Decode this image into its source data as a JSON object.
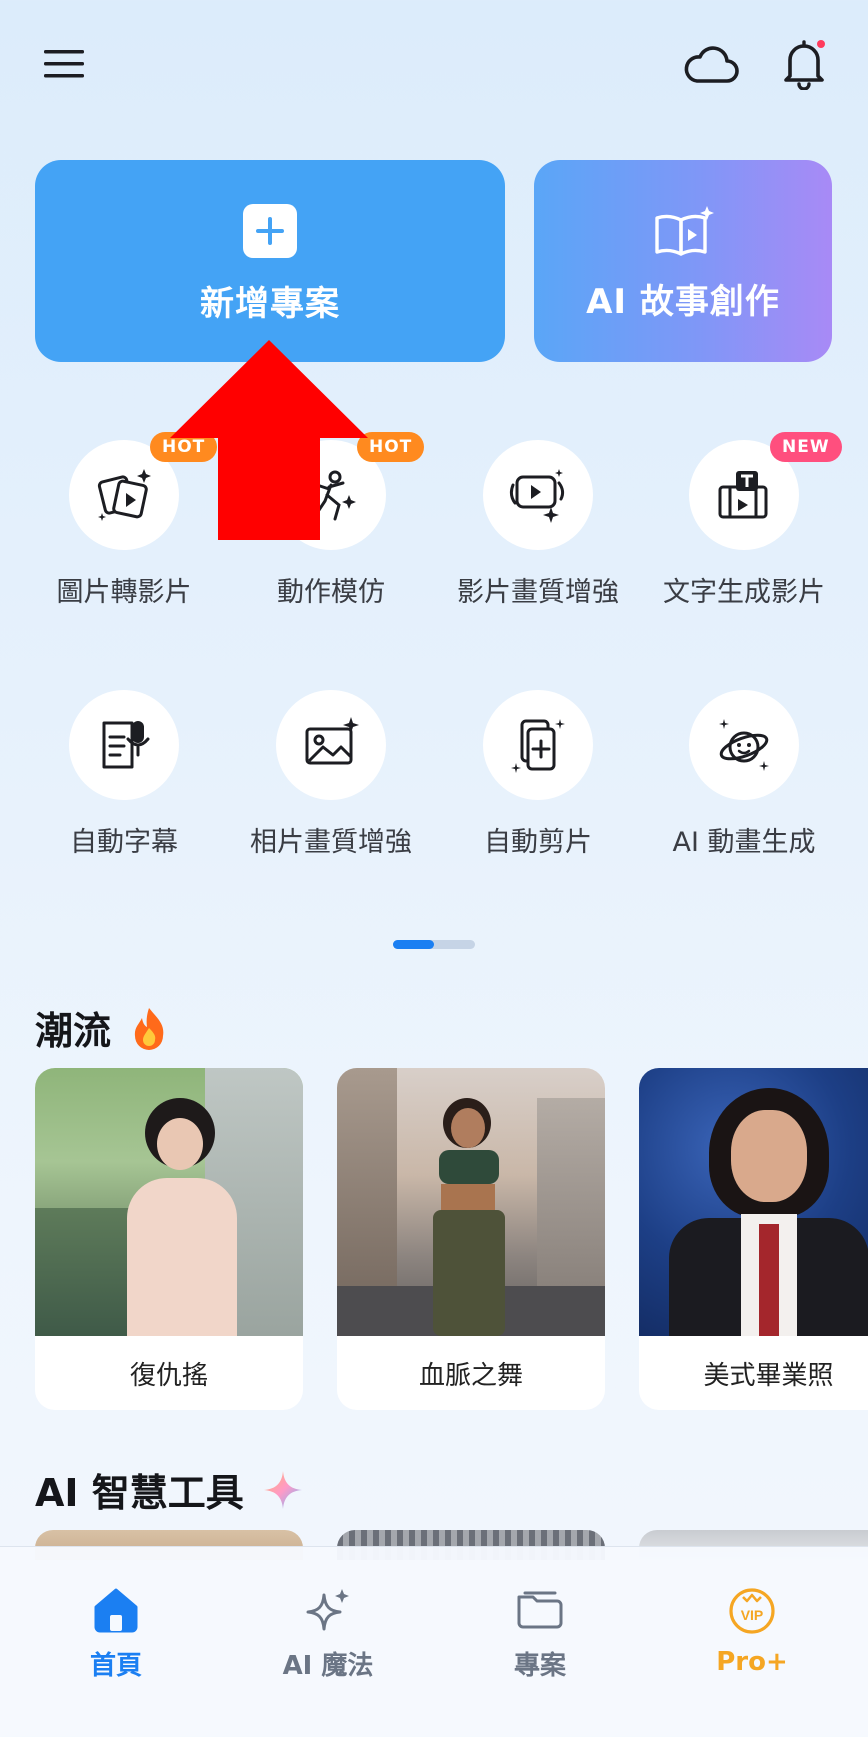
{
  "header": {
    "menu_icon": "hamburger-menu-icon",
    "cloud_icon": "cloud-icon",
    "bell_icon": "bell-icon",
    "notification_dot_color": "#ff3b5c"
  },
  "cards": {
    "new_project_label": "新增專案",
    "story_label": "AI 故事創作"
  },
  "tools": [
    {
      "label": "圖片轉影片",
      "badge": "HOT",
      "icon": "photo-to-video-icon"
    },
    {
      "label": "動作模仿",
      "badge": "HOT",
      "icon": "dance-motion-icon"
    },
    {
      "label": "影片畫質增強",
      "badge": "",
      "icon": "video-enhance-icon"
    },
    {
      "label": "文字生成影片",
      "badge": "NEW",
      "icon": "text-to-video-icon"
    },
    {
      "label": "自動字幕",
      "badge": "",
      "icon": "auto-caption-icon"
    },
    {
      "label": "相片畫質增強",
      "badge": "",
      "icon": "photo-enhance-icon"
    },
    {
      "label": "自動剪片",
      "badge": "",
      "icon": "auto-cut-icon"
    },
    {
      "label": "AI 動畫生成",
      "badge": "",
      "icon": "ai-animation-icon"
    }
  ],
  "pager": {
    "pages": 2,
    "current": 1
  },
  "trending": {
    "title": "潮流",
    "title_icon": "fire-icon",
    "items": [
      {
        "label": "復仇搖"
      },
      {
        "label": "血脈之舞"
      },
      {
        "label": "美式畢業照"
      }
    ]
  },
  "ai_tools": {
    "title": "AI 智慧工具",
    "title_icon": "sparkle-icon"
  },
  "bottom_nav": [
    {
      "label": "首頁",
      "icon": "home-icon",
      "active": true
    },
    {
      "label": "AI 魔法",
      "icon": "magic-sparkle-icon",
      "active": false
    },
    {
      "label": "專案",
      "icon": "folder-icon",
      "active": false
    },
    {
      "label": "Pro+",
      "icon": "vip-icon",
      "active": false
    }
  ],
  "colors": {
    "accent": "#1b7ff2",
    "card_blue": "#44a3f5",
    "hot_badge": "#ff8a1f",
    "new_badge": "#ff4f7e",
    "pro_orange": "#f5a623",
    "annotation_arrow": "#ff0000"
  }
}
